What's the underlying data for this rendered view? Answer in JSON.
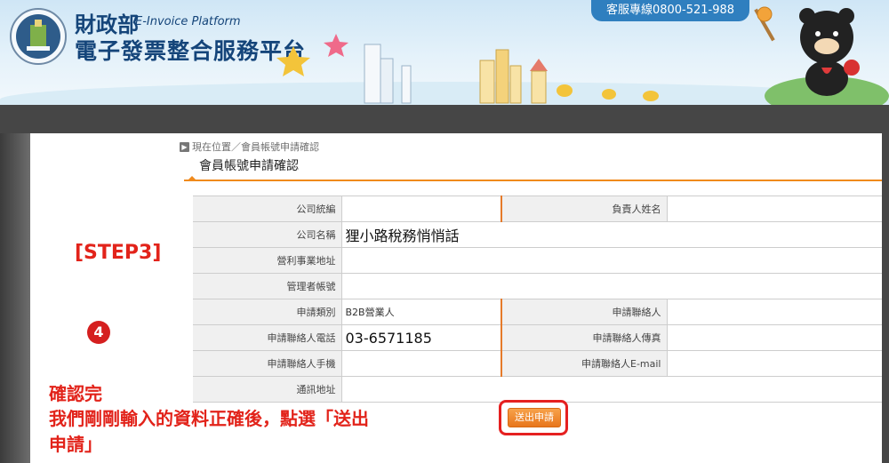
{
  "header": {
    "org_name": "財政部",
    "org_name_en": "E-Invoice Platform",
    "platform_name": "電子發票整合服務平台",
    "hotline": "客服專線0800-521-988"
  },
  "breadcrumb": "現在位置／會員帳號申請確認",
  "page_title": "會員帳號申請確認",
  "form": {
    "rows": [
      {
        "label": "公司統編",
        "value": "",
        "label2": "負責人姓名",
        "value2": ""
      },
      {
        "label": "公司名稱",
        "value": "狸小路稅務悄悄話"
      },
      {
        "label": "營利事業地址",
        "value": ""
      },
      {
        "label": "管理者帳號",
        "value": ""
      },
      {
        "label": "申請類別",
        "value": "B2B營業人",
        "label2": "申請聯絡人",
        "value2": ""
      },
      {
        "label": "申請聯絡人電話",
        "value": "03-6571185",
        "label2": "申請聯絡人傳真",
        "value2": ""
      },
      {
        "label": "申請聯絡人手機",
        "value": "",
        "label2": "申請聯絡人E-mail",
        "value2": ""
      },
      {
        "label": "通訊地址",
        "value": ""
      }
    ]
  },
  "annotation": {
    "step": "[STEP3]",
    "badge": "4",
    "note_line1": "確認完",
    "note_line2": "我們剛剛輸入的資料正確後，點選「送出",
    "note_line3": "申請」"
  },
  "submit_label": "送出申請",
  "colors": {
    "accent": "#f08a1c",
    "annotation": "#e2231a",
    "brand": "#15457a"
  }
}
